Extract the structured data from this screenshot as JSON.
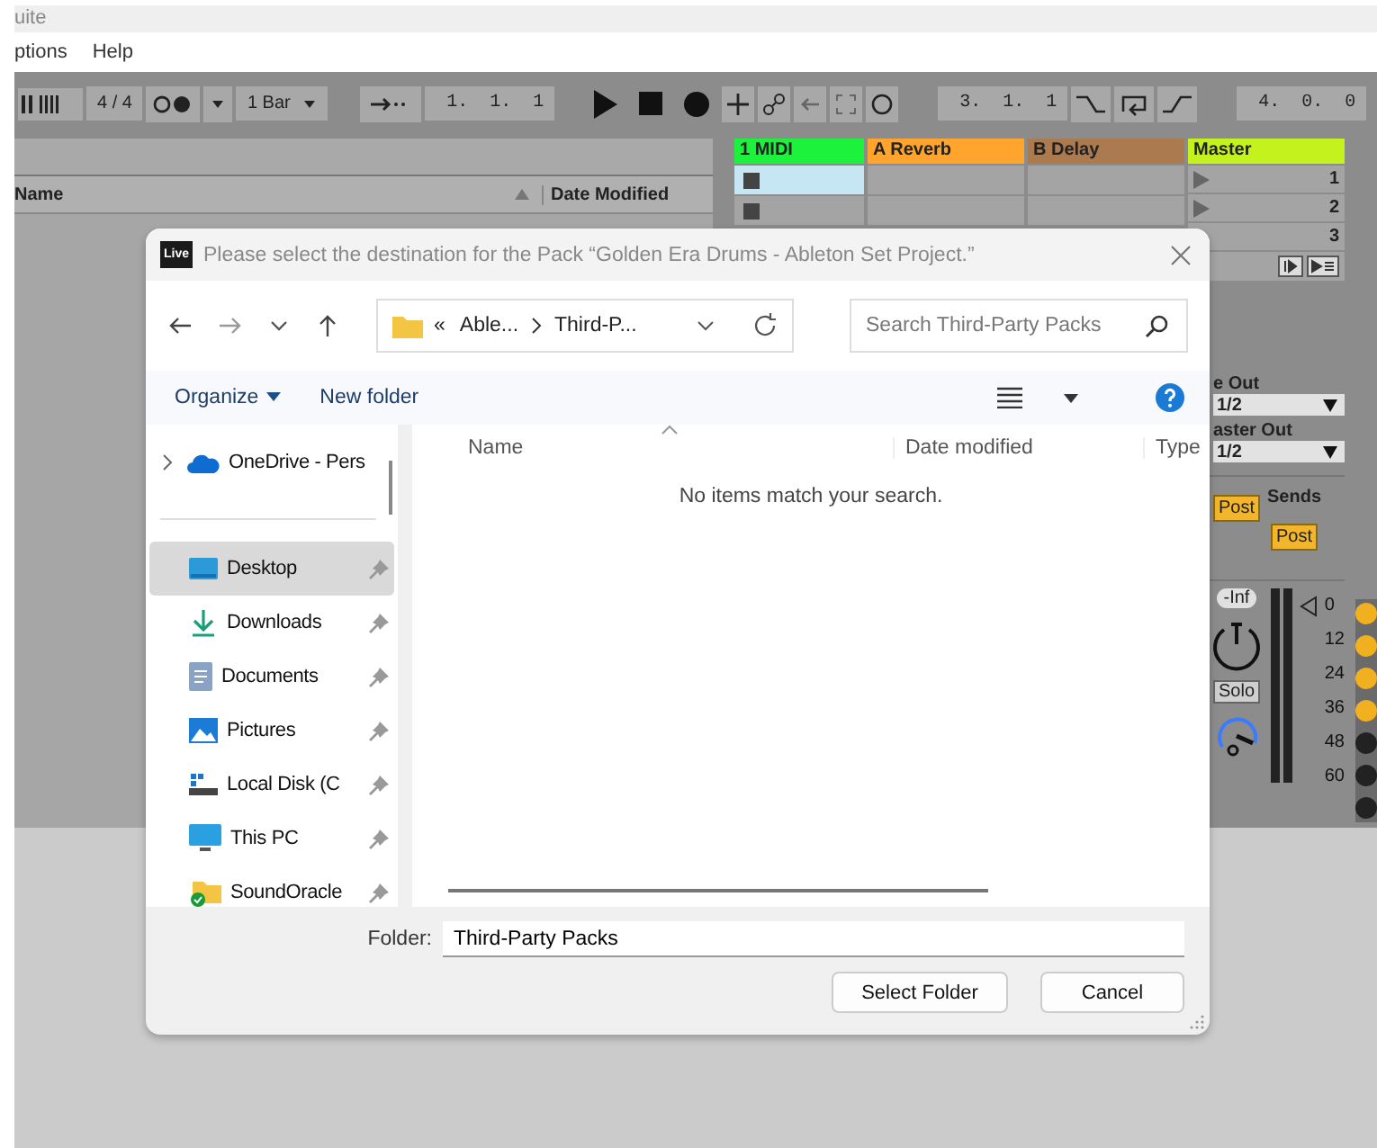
{
  "app": {
    "title": "uite",
    "menu": [
      "ptions",
      "Help"
    ]
  },
  "toolbar": {
    "signature": "4 / 4",
    "quantize": "1 Bar",
    "position": "1.  1.  1",
    "loop_start": "3.  1.  1",
    "loop_length": "4.  0.  0"
  },
  "browser": {
    "columns": [
      "Name",
      "Date Modified"
    ]
  },
  "session": {
    "tracks": [
      {
        "name": "1 MIDI",
        "color": "#1cf23c",
        "kind": "midi",
        "slots": [
          {
            "selected": true
          },
          {
            "selected": false
          }
        ]
      },
      {
        "name": "A Reverb",
        "color": "#ffa42c",
        "kind": "return"
      },
      {
        "name": "B Delay",
        "color": "#ab7b4f",
        "kind": "return"
      }
    ],
    "master": {
      "name": "Master",
      "color": "#c4f21c",
      "scenes": [
        "1",
        "2",
        "3"
      ]
    }
  },
  "mixer": {
    "outputs": [
      {
        "label": "e Out",
        "value": "1/2"
      },
      {
        "label": "aster Out",
        "value": "1/2"
      }
    ],
    "sends_label": "Sends",
    "post_buttons": [
      "Post",
      "Post"
    ],
    "volume": "-Inf",
    "solo": "Solo",
    "scale": [
      "0",
      "12",
      "24",
      "36",
      "48",
      "60"
    ]
  },
  "dialog": {
    "badge": "Live",
    "title": "Please select the destination for the Pack “Golden Era Drums - Ableton Set Project.”",
    "path_overflow": "«",
    "path": [
      "Able...",
      "Third-P..."
    ],
    "search_placeholder": "Search Third-Party Packs",
    "commands": [
      "Organize",
      "New folder"
    ],
    "nav": [
      {
        "label": "OneDrive - Pers",
        "kind": "cloud",
        "selected": false,
        "pinned": false
      },
      {
        "label": "Desktop",
        "kind": "desktop",
        "selected": true,
        "pinned": true
      },
      {
        "label": "Downloads",
        "kind": "download",
        "selected": false,
        "pinned": true
      },
      {
        "label": "Documents",
        "kind": "document",
        "selected": false,
        "pinned": true
      },
      {
        "label": "Pictures",
        "kind": "pictures",
        "selected": false,
        "pinned": true
      },
      {
        "label": "Local Disk (C",
        "kind": "disk",
        "selected": false,
        "pinned": true
      },
      {
        "label": "This PC",
        "kind": "pc",
        "selected": false,
        "pinned": true
      },
      {
        "label": "SoundOracle",
        "kind": "folder",
        "selected": false,
        "pinned": true
      }
    ],
    "columns": [
      "Name",
      "Date modified",
      "Type"
    ],
    "empty_message": "No items match your search.",
    "folder_label": "Folder:",
    "folder_value": "Third-Party Packs",
    "buttons": [
      "Select Folder",
      "Cancel"
    ]
  }
}
